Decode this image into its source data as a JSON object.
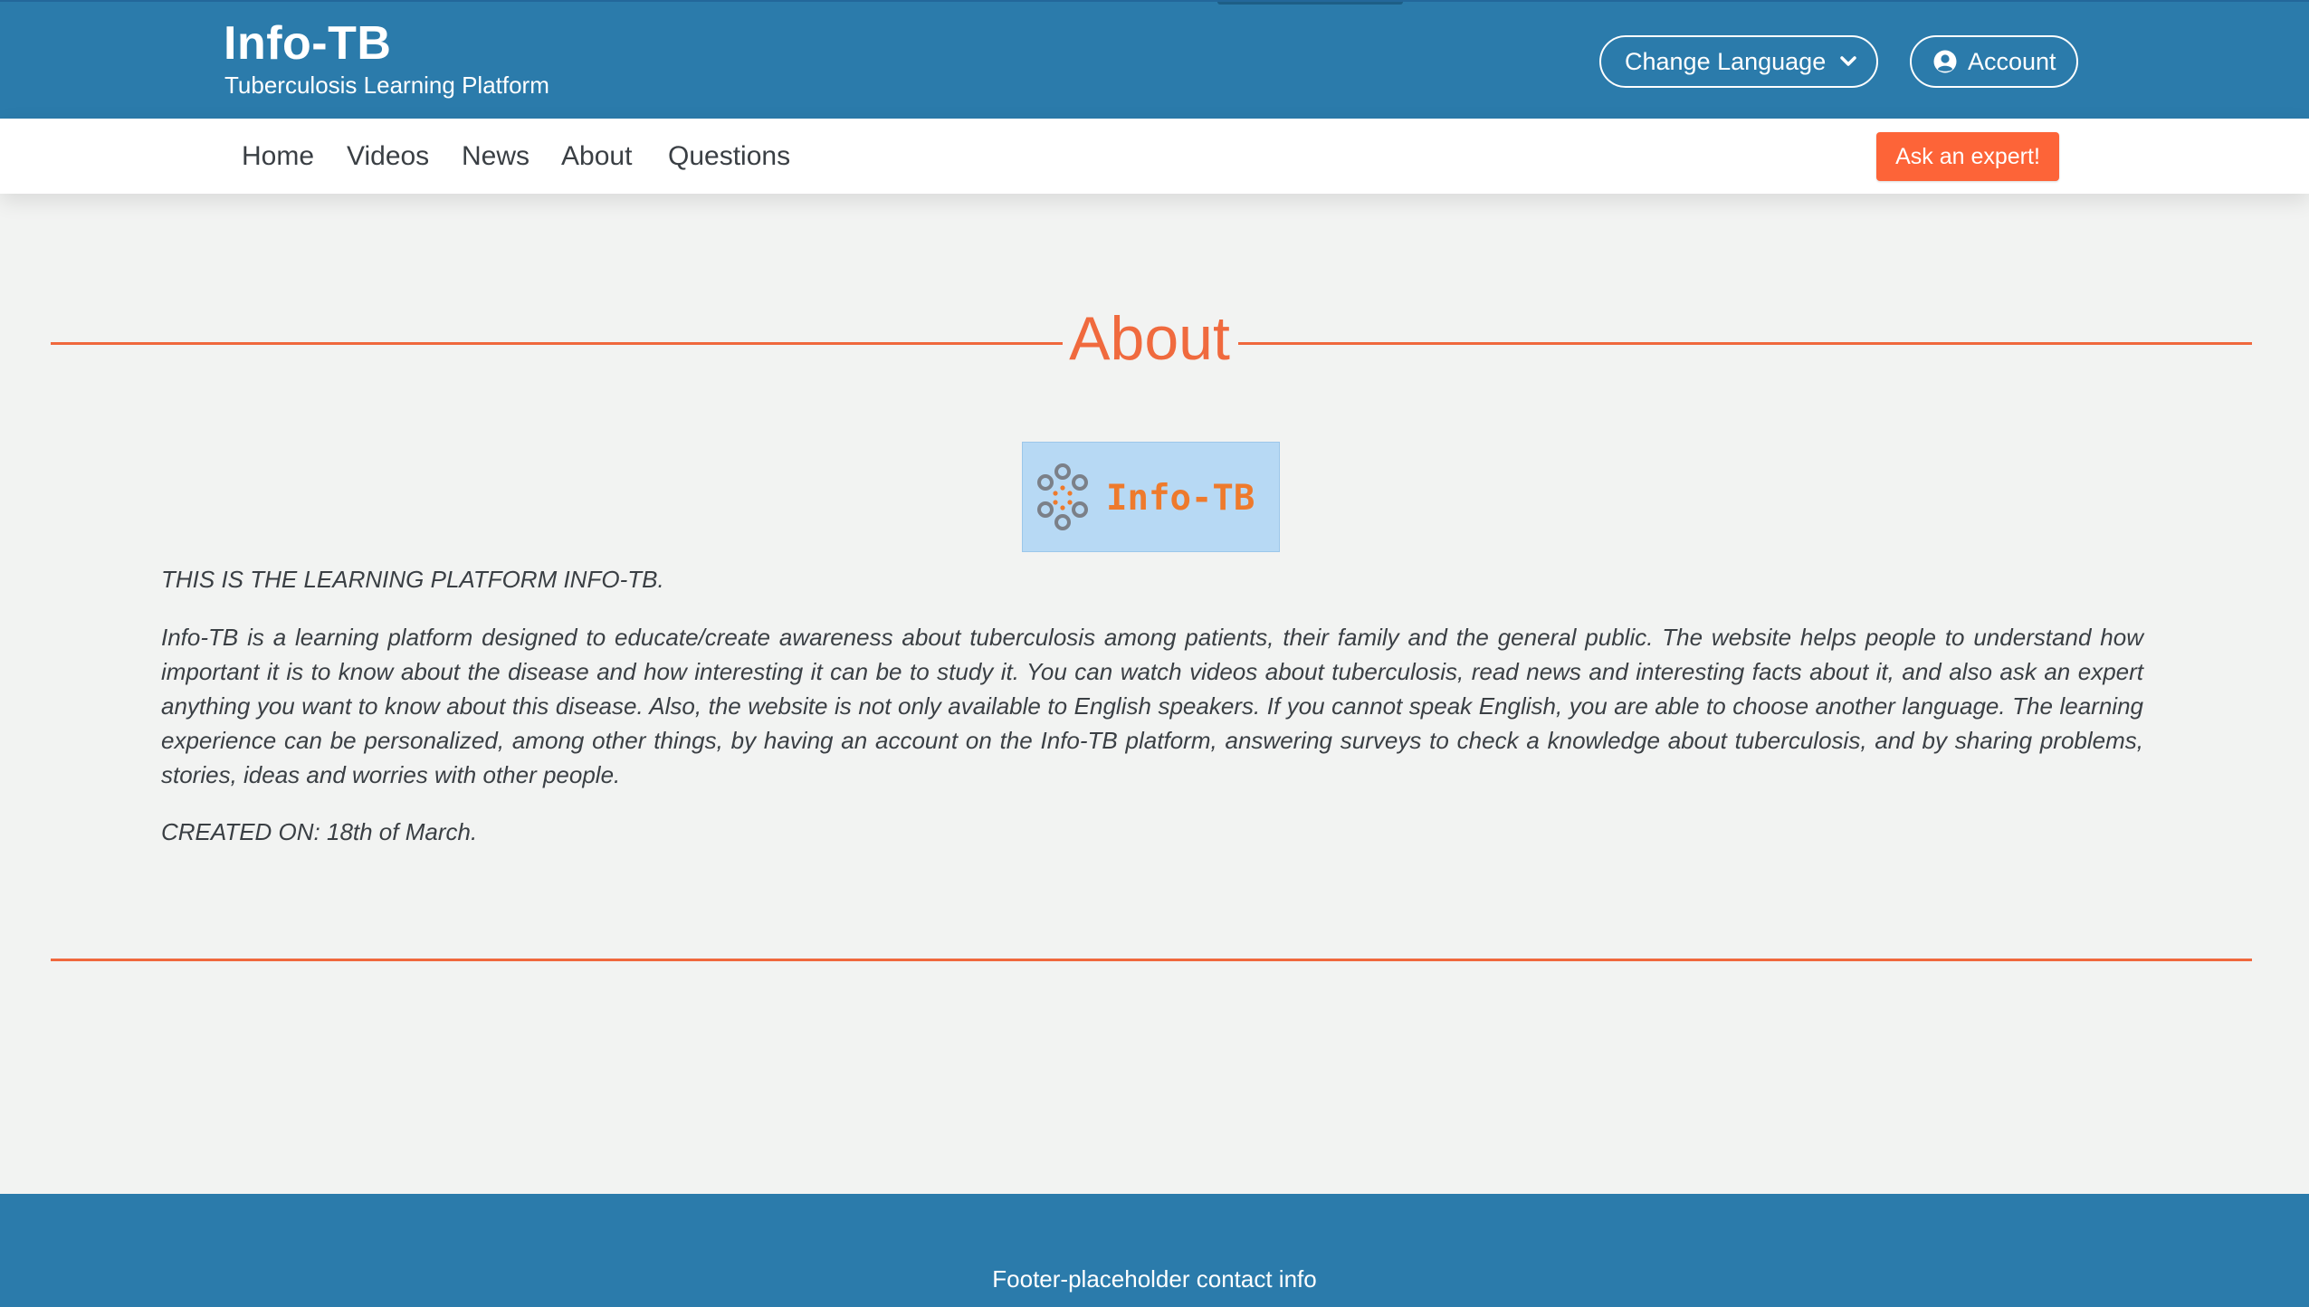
{
  "header": {
    "title": "Info-TB",
    "subtitle": "Tuberculosis Learning Platform",
    "language_button": "Change Language",
    "account_button": "Account",
    "icons": {
      "language": "chevron-down-icon",
      "account": "user-circle-icon"
    }
  },
  "nav": {
    "items": [
      "Home",
      "Videos",
      "News",
      "About",
      "Questions"
    ],
    "cta": "Ask an expert!"
  },
  "main": {
    "section_title": "About",
    "logo_text": "Info-TB",
    "heading": "THIS IS THE LEARNING PLATFORM INFO-TB.",
    "body": "Info-TB is a learning platform designed to educate/create awareness about tuberculosis among patients, their family and the general public. The website helps people to understand how important it is to know about the disease and how interesting it can be to study it. You can watch videos about tuberculosis, read news and interesting facts about it, and also ask an expert anything you want to know about this disease. Also, the website is not only available to English speakers. If you cannot speak English, you are able to choose another language. The learning experience can be personalized, among other things, by having an account on the Info-TB platform, answering surveys to check a knowledge about tuberculosis, and by sharing problems, stories, ideas and worries with other people.",
    "created": "CREATED ON: 18th of March."
  },
  "footer": {
    "text": "Footer-placeholder contact info"
  },
  "colors": {
    "brand_blue": "#2b7bab",
    "accent_orange": "#f06a3e",
    "cta_orange": "#fd6438",
    "page_background": "#f2f3f2"
  }
}
